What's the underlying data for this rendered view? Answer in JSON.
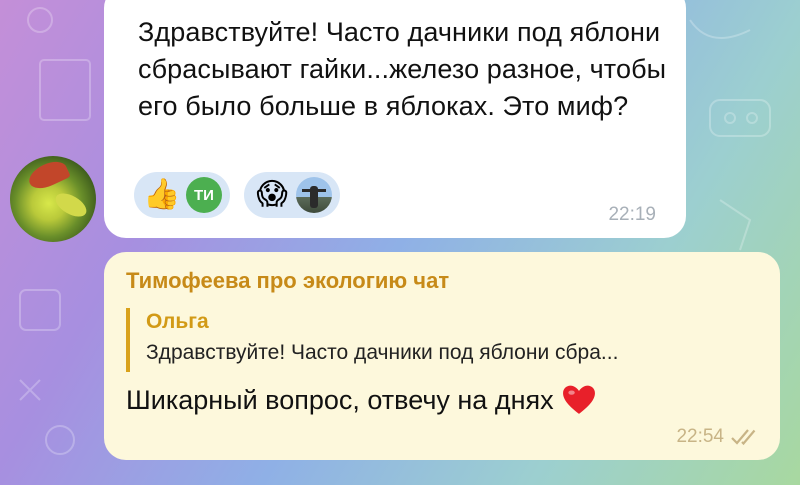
{
  "incoming_message": {
    "text": "Здравствуйте! Часто дачники под яблони сбрасывают гайки...железо разное, чтобы его было больше в яблоках. Это миф?",
    "time": "22:19",
    "reactions": [
      {
        "emoji": "👍",
        "avatar_initials": "ТИ",
        "avatar_color": "#4caf50"
      },
      {
        "emoji": "😱",
        "avatar_icon": "person-photo-icon"
      }
    ]
  },
  "outgoing_message": {
    "chat_name": "Тимофеева про экологию чат",
    "reply": {
      "author": "Ольга",
      "text": "Здравствуйте! Часто дачники под яблони сбра..."
    },
    "text": "Шикарный вопрос, отвечу на днях",
    "emoji_icon": "heart-icon",
    "time": "22:54",
    "status_icon": "double-check-icon"
  },
  "colors": {
    "incoming_bubble": "#ffffff",
    "outgoing_bubble": "#fdf8dc",
    "accent_name": "#c78a18",
    "reaction_bg": "#d8e6f6"
  }
}
